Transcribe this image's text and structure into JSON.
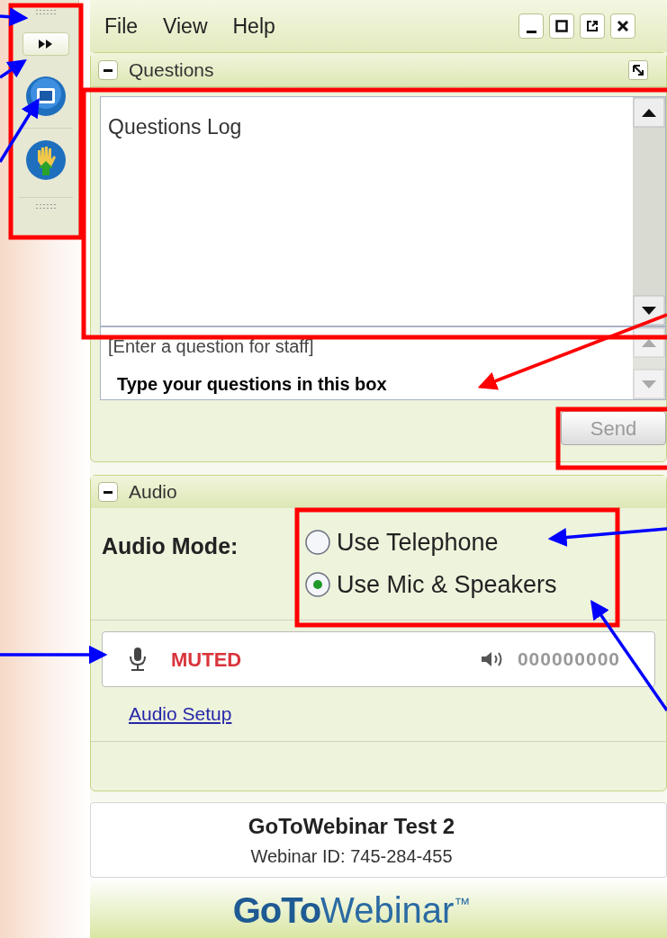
{
  "menu": [
    "File",
    "View",
    "Help"
  ],
  "questions": {
    "title": "Questions",
    "expanded": true,
    "log_title": "Questions Log",
    "input_placeholder": "[Enter a question for staff]",
    "send_button": {
      "label": "Send",
      "disabled": true
    }
  },
  "callout": "Type your questions in this box",
  "audio": {
    "title": "Audio",
    "expanded": true,
    "mode_label": "Audio Mode:",
    "options": [
      {
        "label": "Use Telephone",
        "selected": false
      },
      {
        "label": "Use Mic & Speakers",
        "selected": true
      }
    ],
    "mic_status": "MUTED",
    "speaker_meter": "000000000",
    "setup_link": "Audio Setup"
  },
  "footer": {
    "title": "GoToWebinar Test 2",
    "webinar_id": "Webinar ID: 745-284-455",
    "logo_bold": "GoTo",
    "logo_rest": "Webinar",
    "logo_mark": "™"
  }
}
